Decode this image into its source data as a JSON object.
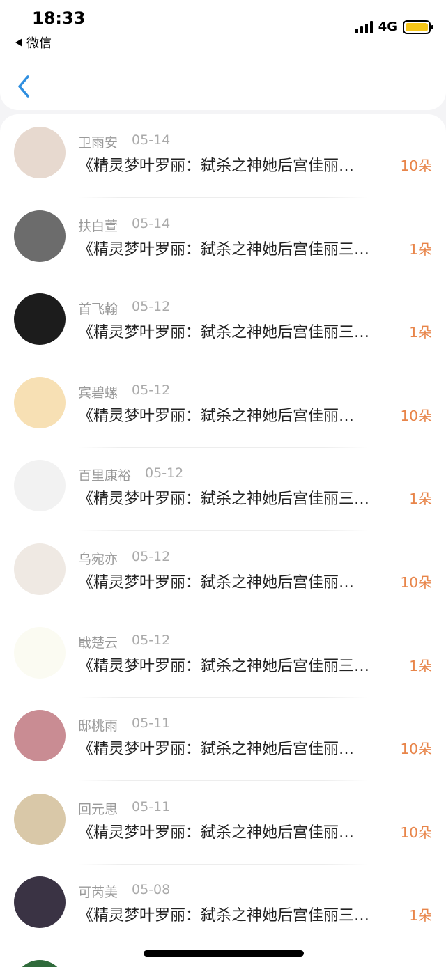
{
  "status": {
    "time": "18:33",
    "back_app": "微信",
    "network": "4G"
  },
  "colors": {
    "accent": "#2f8fe0",
    "flower": "#e8854a"
  },
  "items": [
    {
      "name": "卫雨安",
      "date": "05-14",
      "book": "《精灵梦叶罗丽：弑杀之神她后宫佳丽…",
      "count": "10朵",
      "avatar_color": "#e7d9cf"
    },
    {
      "name": "扶白萱",
      "date": "05-14",
      "book": "《精灵梦叶罗丽：弑杀之神她后宫佳丽三…",
      "count": "1朵",
      "avatar_color": "#6c6c6c"
    },
    {
      "name": "首飞翰",
      "date": "05-12",
      "book": "《精灵梦叶罗丽：弑杀之神她后宫佳丽三…",
      "count": "1朵",
      "avatar_color": "#1c1c1c"
    },
    {
      "name": "宾碧螺",
      "date": "05-12",
      "book": "《精灵梦叶罗丽：弑杀之神她后宫佳丽…",
      "count": "10朵",
      "avatar_color": "#f7e0b4"
    },
    {
      "name": "百里康裕",
      "date": "05-12",
      "book": "《精灵梦叶罗丽：弑杀之神她后宫佳丽三…",
      "count": "1朵",
      "avatar_color": "#f2f2f2"
    },
    {
      "name": "乌宛亦",
      "date": "05-12",
      "book": "《精灵梦叶罗丽：弑杀之神她后宫佳丽…",
      "count": "10朵",
      "avatar_color": "#efe9e3"
    },
    {
      "name": "戢楚云",
      "date": "05-12",
      "book": "《精灵梦叶罗丽：弑杀之神她后宫佳丽三…",
      "count": "1朵",
      "avatar_color": "#fbfbf2"
    },
    {
      "name": "邸桃雨",
      "date": "05-11",
      "book": "《精灵梦叶罗丽：弑杀之神她后宫佳丽…",
      "count": "10朵",
      "avatar_color": "#c98c93"
    },
    {
      "name": "回元思",
      "date": "05-11",
      "book": "《精灵梦叶罗丽：弑杀之神她后宫佳丽…",
      "count": "10朵",
      "avatar_color": "#d9c8a8"
    },
    {
      "name": "可芮美",
      "date": "05-08",
      "book": "《精灵梦叶罗丽：弑杀之神她后宫佳丽三…",
      "count": "1朵",
      "avatar_color": "#3a3344"
    }
  ]
}
